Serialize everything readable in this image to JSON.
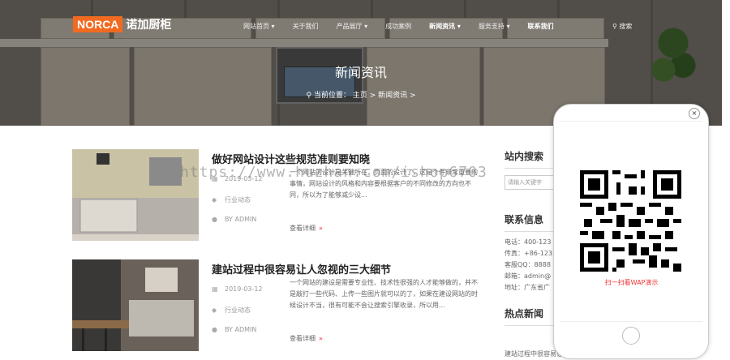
{
  "brand": {
    "badge": "NORCA",
    "name": "诺加厨柜"
  },
  "nav": {
    "items": [
      "网站首页 ▾",
      "关于我们",
      "产品展厅 ▾",
      "成功案例",
      "新闻资讯 ▾",
      "服务支持 ▾",
      "联系我们"
    ],
    "search_label": "搜索"
  },
  "hero": {
    "title": "新闻资讯",
    "breadcrumb": "当前位置： 主页 > 新闻资讯 >"
  },
  "articles": [
    {
      "title": "做好网站设计这些规范准则要知晓",
      "date": "2019-03-12",
      "category": "行业动态",
      "author": "BY ADMIN",
      "summary": "一个网站的设计是关键所在，页面的设计了，这是个件非常重要的事情，网站设计的风格和内容要根据客户的不同修改的方向也不同，所以为了能够减少设...",
      "more": "查看详细"
    },
    {
      "title": "建站过程中很容易让人忽视的三大细节",
      "date": "2019-03-12",
      "category": "行业动态",
      "author": "BY ADMIN",
      "summary": "一个网站的建设是需要专业性、技术性很强的人才能够做的，并不是敲打一些代码、上传一些图片就可以的了，如果在建设网站的时候设计不当，很有可能不会让搜索引擎收录，所以用...",
      "more": "查看详细"
    }
  ],
  "sidebar": {
    "search_title": "站内搜索",
    "search_placeholder": "请输入关键字",
    "contact_title": "联系信息",
    "contact_lines": [
      "电话：400-123",
      "传真：+86-123",
      "客服QQ：8888",
      "邮箱：admin@",
      "地址：广东省广"
    ],
    "hot_title": "热点新闻",
    "hot_first": "建站过程中很容易让人忽视"
  },
  "popup": {
    "caption": "扫一扫看WAP演示",
    "close": "×"
  },
  "watermark": "https://www.huzhan.com/ishop6703"
}
